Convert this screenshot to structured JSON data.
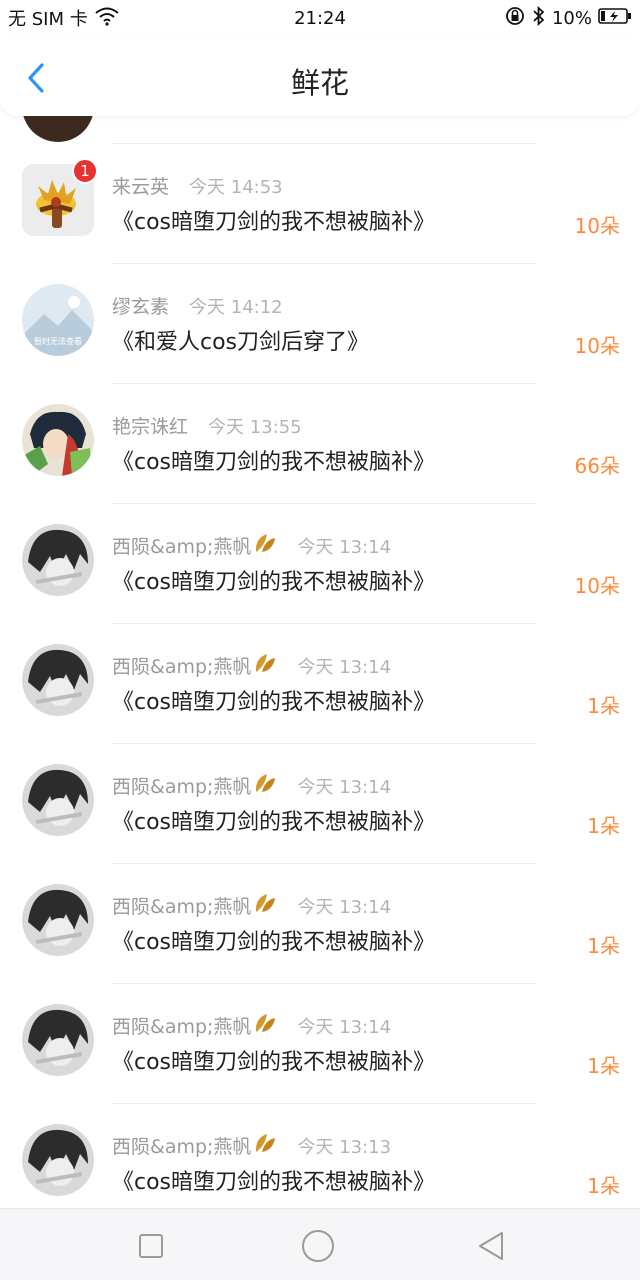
{
  "status_bar": {
    "carrier": "无 SIM 卡",
    "time": "21:24",
    "battery": "10%"
  },
  "header": {
    "title": "鲜花"
  },
  "rows": [
    {
      "name": "来云英",
      "time": "今天 14:53",
      "title": "《cos暗堕刀剑的我不想被脑补》",
      "amount": "10朵",
      "badge": "1",
      "leaf": false
    },
    {
      "name": "缪玄素",
      "time": "今天 14:12",
      "title": "《和爱人cos刀剑后穿了》",
      "amount": "10朵",
      "avatar_caption": "暂时无法查看",
      "leaf": false
    },
    {
      "name": "艳宗诛红",
      "time": "今天 13:55",
      "title": "《cos暗堕刀剑的我不想被脑补》",
      "amount": "66朵",
      "leaf": false
    },
    {
      "name": "西陨&amp;燕帆",
      "time": "今天 13:14",
      "title": "《cos暗堕刀剑的我不想被脑补》",
      "amount": "10朵",
      "leaf": true
    },
    {
      "name": "西陨&amp;燕帆",
      "time": "今天 13:14",
      "title": "《cos暗堕刀剑的我不想被脑补》",
      "amount": "1朵",
      "leaf": true
    },
    {
      "name": "西陨&amp;燕帆",
      "time": "今天 13:14",
      "title": "《cos暗堕刀剑的我不想被脑补》",
      "amount": "1朵",
      "leaf": true
    },
    {
      "name": "西陨&amp;燕帆",
      "time": "今天 13:14",
      "title": "《cos暗堕刀剑的我不想被脑补》",
      "amount": "1朵",
      "leaf": true
    },
    {
      "name": "西陨&amp;燕帆",
      "time": "今天 13:14",
      "title": "《cos暗堕刀剑的我不想被脑补》",
      "amount": "1朵",
      "leaf": true
    },
    {
      "name": "西陨&amp;燕帆",
      "time": "今天 13:13",
      "title": "《cos暗堕刀剑的我不想被脑补》",
      "amount": "1朵",
      "leaf": true
    }
  ],
  "colors": {
    "accent_blue": "#2b96f0",
    "amount_orange": "#ff8a3d",
    "badge_red": "#e8322f"
  },
  "icons": {
    "back": "chevron-left-icon",
    "wifi": "wifi-icon",
    "lock_rotation": "rotation-lock-icon",
    "bluetooth": "bluetooth-icon",
    "battery": "battery-charging-icon",
    "leaf": "leaf-icon",
    "nav_recent": "square-icon",
    "nav_home": "circle-icon",
    "nav_back": "triangle-back-icon"
  }
}
